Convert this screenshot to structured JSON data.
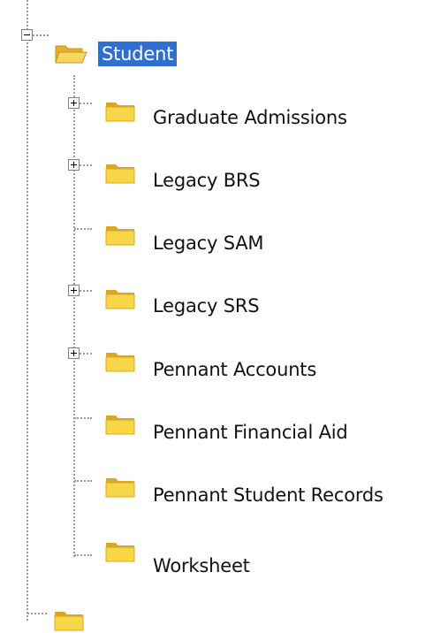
{
  "tree": {
    "root": {
      "label": "Student",
      "expanded": true,
      "selected": true,
      "icon": "folder-open-icon"
    },
    "children": [
      {
        "label": "Graduate Admissions",
        "has_children": true,
        "icon": "folder-icon"
      },
      {
        "label": "Legacy BRS",
        "has_children": true,
        "icon": "folder-icon"
      },
      {
        "label": "Legacy SAM",
        "has_children": false,
        "icon": "folder-icon"
      },
      {
        "label": "Legacy SRS",
        "has_children": true,
        "icon": "folder-icon"
      },
      {
        "label": "Pennant Accounts",
        "has_children": true,
        "icon": "folder-icon"
      },
      {
        "label": "Pennant Financial Aid",
        "has_children": false,
        "icon": "folder-icon"
      },
      {
        "label": "Pennant Student Records",
        "has_children": false,
        "icon": "folder-icon"
      },
      {
        "label": "Worksheet",
        "has_children": false,
        "icon": "folder-icon"
      }
    ]
  },
  "colors": {
    "selection": "#2f6fcf",
    "folder_fill": "#f6d44a",
    "folder_dark": "#d8a720",
    "dotted_line": "#9a9a9a"
  }
}
